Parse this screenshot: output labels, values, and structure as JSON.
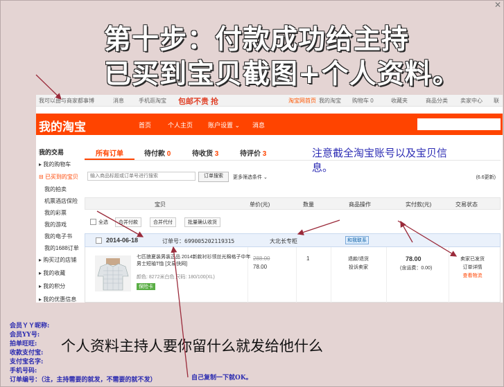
{
  "window": {
    "close_glyph": "✕"
  },
  "title": {
    "line1": "第十步：付款成功给主持",
    "line2": "已买到宝贝截图+个人资料。"
  },
  "taobao": {
    "topbar": {
      "left_text": "我可以由与商家都事博",
      "msg": "消息",
      "mobile": "手机逛淘宝",
      "promo": "包邮不贵 抢",
      "home": "淘宝网首页",
      "my_taobao": "我的淘宝",
      "cart": "购物车 0",
      "favorites": "收藏夹",
      "category": "商品分类",
      "seller": "卖家中心",
      "more": "联"
    },
    "header": {
      "logo": "我的淘宝",
      "nav": [
        "首页",
        "个人主页",
        "账户设置 ⌄",
        "消息"
      ]
    },
    "sidebar": {
      "title": "我的交易",
      "items": [
        "我的购物车",
        "已买到的宝贝",
        "我的拍卖",
        "机票酒店保险",
        "我的彩票",
        "我的游戏",
        "我的电子书",
        "我的1688订单",
        "购买过的店铺",
        "我的收藏",
        "我的积分",
        "我的优惠信息"
      ]
    },
    "tabs": [
      {
        "label": "所有订单",
        "count": ""
      },
      {
        "label": "待付款",
        "count": "0"
      },
      {
        "label": "待收货",
        "count": "3"
      },
      {
        "label": "待评价",
        "count": "3"
      }
    ],
    "search": {
      "placeholder": "输入商品标题或订单号进行搜索",
      "button": "订单搜索",
      "more_filter": "更多筛选条件 ⌄",
      "page_count": "(6.6更新)"
    },
    "columns": [
      "宝贝",
      "单价(元)",
      "数量",
      "商品操作",
      "实付款(元)",
      "交易状态"
    ],
    "batch": {
      "select_all": "全选",
      "buttons": [
        "合并付款",
        "合并代付",
        "批量确认收货"
      ]
    },
    "order": {
      "date": "2014-06-18",
      "order_no_label": "订单号：",
      "order_no": "699005202119315",
      "shop": "大北长专柜",
      "contact": "和我联系",
      "product_name": "七匹狼夏装男装正品 2014新款衬衫领丝光棉格子中年男士短袖T恤 [文易快网]",
      "sku": "颜色: 8272米白色 尺码: 180/100(XL)",
      "badge": "保险卡",
      "price_old": "288.00",
      "price_new": "78.00",
      "qty": "1",
      "ops": [
        "退款/退货",
        "投诉卖家"
      ],
      "paid": "78.00",
      "freight": "(含运费：0.00)",
      "status": [
        "卖家已发货",
        "订单详情"
      ],
      "status_link": "查看物流"
    }
  },
  "note": "注意截全淘宝账号以及宝贝信息。",
  "info_fields": [
    "会员ＹＹ昵称:",
    "会员YY号:",
    "拍单旺旺:",
    "收款支付宝:",
    "支付宝名字:",
    "手机号码:",
    "订单编号：（注，主持需要的就发，不需要的就不发）"
  ],
  "info_note": "个人资料主持人要你留什么就发给他什么",
  "copy_note": "自己复制一下就OK。"
}
